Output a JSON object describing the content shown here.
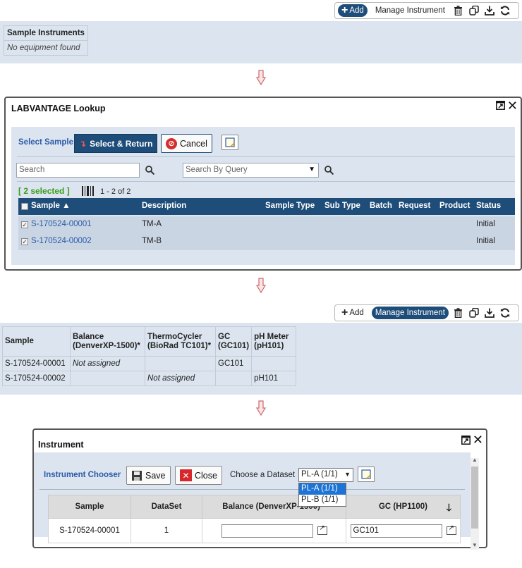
{
  "toolbar1": {
    "add_label": "Add",
    "manage_label": "Manage Instrument"
  },
  "sample_instruments": {
    "header": "Sample Instruments",
    "empty_text": "No equipment found"
  },
  "lookup_dialog": {
    "title": "LABVANTAGE Lookup",
    "section_label": "Select Sample",
    "select_return_label": "Select & Return",
    "cancel_label": "Cancel",
    "search_placeholder": "Search",
    "query_placeholder": "Search By Query",
    "selected_text": "[ 2 selected ]",
    "count_text": "1 - 2 of 2",
    "columns": [
      "Sample ▲",
      "Description",
      "Sample Type",
      "Sub Type",
      "Batch",
      "Request",
      "Product",
      "Status"
    ],
    "rows": [
      {
        "sample": "S-170524-00001",
        "description": "TM-A",
        "status": "Initial"
      },
      {
        "sample": "S-170524-00002",
        "description": "TM-B",
        "status": "Initial"
      }
    ]
  },
  "toolbar2": {
    "add_label": "Add",
    "manage_label": "Manage Instrument"
  },
  "instrument_matrix": {
    "headers": {
      "sample": "Sample",
      "balance": [
        "Balance",
        "(DenverXP-1500)*"
      ],
      "thermo": [
        "ThermoCycler",
        "(BioRad TC101)*"
      ],
      "gc": [
        "GC",
        "(GC101)"
      ],
      "ph": [
        "pH Meter",
        "(pH101)"
      ]
    },
    "rows": [
      {
        "sample": "S-170524-00001",
        "balance": "Not assigned",
        "thermo": "",
        "gc": "GC101",
        "ph": ""
      },
      {
        "sample": "S-170524-00002",
        "balance": "",
        "thermo": "Not assigned",
        "gc": "",
        "ph": "pH101"
      }
    ]
  },
  "instrument_dialog": {
    "title": "Instrument",
    "chooser_label": "Instrument Chooser",
    "save_label": "Save",
    "close_label": "Close",
    "dataset_label": "Choose a Dataset",
    "dataset_value": "PL-A (1/1)",
    "dataset_options": [
      "PL-A (1/1)",
      "PL-B (1/1)"
    ],
    "columns": [
      "Sample",
      "DataSet",
      "Balance (DenverXP-1500) *",
      "GC (HP1100)"
    ],
    "row": {
      "sample": "S-170524-00001",
      "dataset": "1",
      "balance_value": "",
      "gc_value": "GC101"
    }
  }
}
